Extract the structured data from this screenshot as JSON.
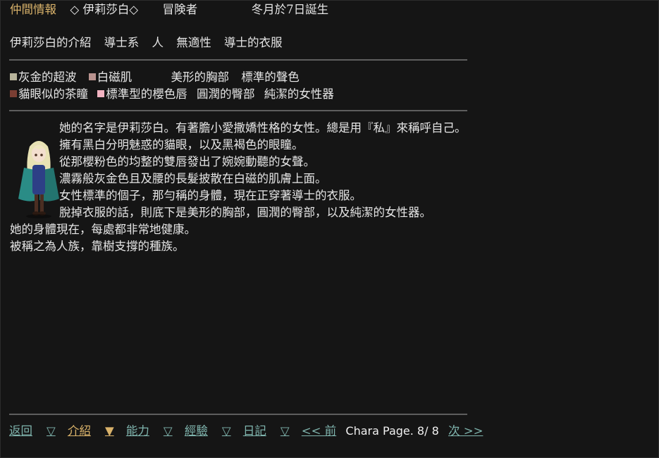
{
  "header": {
    "title": "仲間情報",
    "name": "◇ 伊莉莎白◇",
    "role": "冒険者",
    "birthday": "冬月於7日誕生"
  },
  "intro": {
    "items": [
      "伊莉莎白的介紹",
      "導士系",
      "人",
      "無適性",
      "導士的衣服"
    ]
  },
  "traits": {
    "row1": [
      {
        "swatch": "#b7b39a",
        "text": "灰金的超波"
      },
      {
        "swatch": "#b9938f",
        "text": "白磁肌"
      },
      {
        "swatch": null,
        "text": "美形的胸部"
      },
      {
        "swatch": null,
        "text": "標準的聲色"
      }
    ],
    "row2": [
      {
        "swatch": "#7a3e33",
        "text": "貓眼似的茶瞳"
      },
      {
        "swatch": "#f2b3c1",
        "text": "標準型的櫻色唇"
      },
      {
        "swatch": null,
        "text": "圓潤的臀部"
      },
      {
        "swatch": null,
        "text": "純潔的女性器"
      }
    ]
  },
  "description": {
    "lines": [
      "她的名字是伊莉莎白。有著膽小愛撒嬌性格的女性。總是用『私』來稱呼自己。",
      "擁有黑白分明魅惑的貓眼，以及黑褐色的眼瞳。",
      "從那櫻粉色的均整的雙唇發出了婉婉動聽的女聲。",
      "濃霧般灰金色且及腰的長髮披散在白磁的肌膚上面。",
      "女性標準的個子，那勻稱的身體，現在正穿著導士的衣服。",
      "脫掉衣服的話，則底下是美形的胸部，圓潤的臀部，以及純潔的女性器。",
      "她的身體現在，每處都非常地健康。",
      "被稱之為人族，靠樹支撐的種族。"
    ]
  },
  "footer": {
    "nav": [
      {
        "label": "返回",
        "arrow": "▽"
      },
      {
        "label": "介紹",
        "arrow": "▼"
      },
      {
        "label": "能力",
        "arrow": "▽"
      },
      {
        "label": "經驗",
        "arrow": "▽"
      },
      {
        "label": "日記",
        "arrow": "▽"
      }
    ],
    "prev": "<< 前",
    "page_label": "Chara Page. 8/ 8",
    "next": "次 >>"
  }
}
